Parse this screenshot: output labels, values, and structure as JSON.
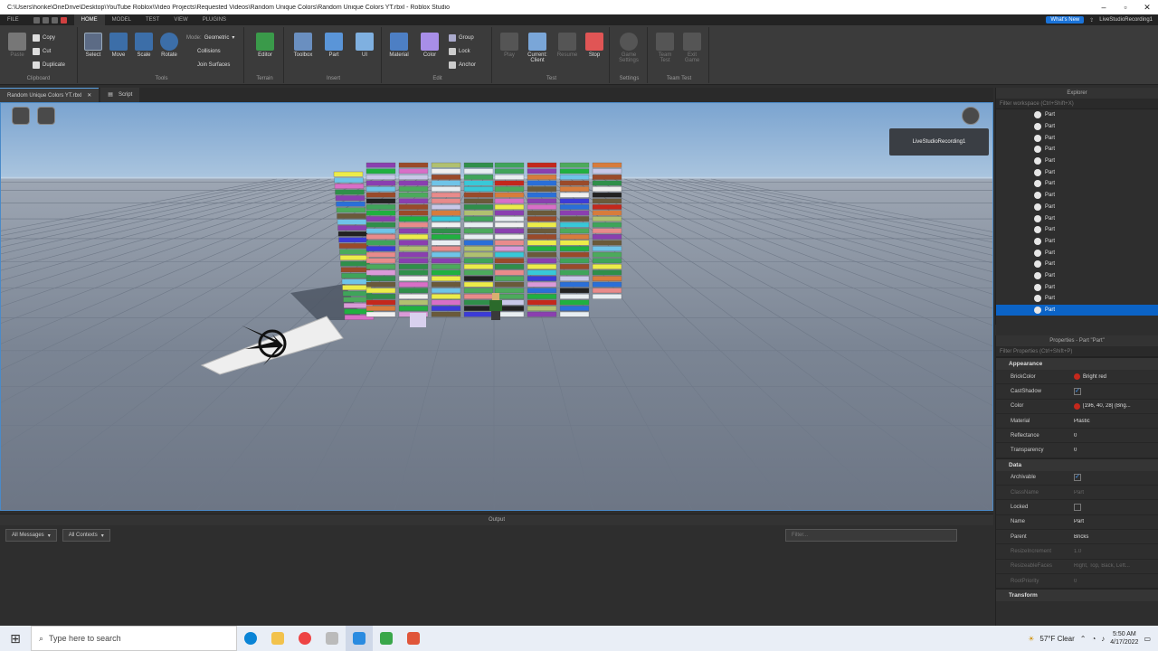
{
  "window": {
    "title": "C:\\Users\\honke\\OneDrive\\Desktop\\YouTube Roblox\\Video Projects\\Requested Videos\\Random Unique Colors\\Random Unique Colors YT.rbxl - Roblox Studio"
  },
  "menu": {
    "file": "FILE",
    "tabs": [
      "HOME",
      "MODEL",
      "TEST",
      "VIEW",
      "PLUGINS"
    ],
    "whats_new": "What's New",
    "user": "LiveStudioRecording1"
  },
  "ribbon": {
    "clipboard": {
      "paste": "Paste",
      "copy": "Copy",
      "cut": "Cut",
      "duplicate": "Duplicate",
      "label": "Clipboard"
    },
    "tools": {
      "select": "Select",
      "move": "Move",
      "scale": "Scale",
      "rotate": "Rotate",
      "mode_label": "Mode:",
      "mode_value": "Geometric",
      "collisions": "Collisions",
      "join_surfaces": "Join Surfaces",
      "label": "Tools"
    },
    "terrain": {
      "editor": "Editor",
      "label": "Terrain"
    },
    "insert": {
      "toolbox": "Toolbox",
      "part": "Part",
      "ui": "UI",
      "label": "Insert"
    },
    "edit": {
      "material": "Material",
      "color": "Color",
      "group": "Group",
      "lock": "Lock",
      "anchor": "Anchor",
      "label": "Edit"
    },
    "test": {
      "play": "Play",
      "current_client": "Current: Client",
      "resume": "Resume",
      "stop": "Stop",
      "label": "Test"
    },
    "settings": {
      "game_settings": "Game Settings",
      "label": "Settings"
    },
    "team_test": {
      "team_test": "Team Test",
      "exit_game": "Exit Game",
      "label": "Team Test"
    }
  },
  "doc_tabs": [
    {
      "label": "Random Unique Colors YT.rbxl"
    },
    {
      "label": "Script"
    }
  ],
  "viewport": {
    "recording_label": "LiveStudioRecording1"
  },
  "output": {
    "title": "Output",
    "messages_filter": "All Messages",
    "contexts_filter": "All Contexts",
    "filter_placeholder": "Filter..."
  },
  "explorer": {
    "title": "Explorer",
    "filter_placeholder": "Filter workspace (Ctrl+Shift+X)",
    "items": [
      "Part",
      "Part",
      "Part",
      "Part",
      "Part",
      "Part",
      "Part",
      "Part",
      "Part",
      "Part",
      "Part",
      "Part",
      "Part",
      "Part",
      "Part",
      "Part",
      "Part",
      "Part"
    ]
  },
  "properties": {
    "title": "Properties - Part \"Part\"",
    "filter_placeholder": "Filter Properties (Ctrl+Shift+P)",
    "sections": {
      "appearance": "Appearance",
      "data": "Data",
      "transform": "Transform"
    },
    "appearance_rows": [
      {
        "key": "BrickColor",
        "value": "Bright red",
        "swatch": "#c4281c"
      },
      {
        "key": "CastShadow",
        "value": "✓"
      },
      {
        "key": "Color",
        "value": "[196, 40, 28] (Brig...",
        "swatch": "#c4281c"
      },
      {
        "key": "Material",
        "value": "Plastic"
      },
      {
        "key": "Reflectance",
        "value": "0"
      },
      {
        "key": "Transparency",
        "value": "0"
      }
    ],
    "data_rows": [
      {
        "key": "Archivable",
        "value": "✓"
      },
      {
        "key": "ClassName",
        "value": "Part",
        "dim": true
      },
      {
        "key": "Locked",
        "value": ""
      },
      {
        "key": "Name",
        "value": "Part"
      },
      {
        "key": "Parent",
        "value": "Bricks"
      },
      {
        "key": "ResizeIncrement",
        "value": "1.0",
        "dim": true
      },
      {
        "key": "ResizeableFaces",
        "value": "Right, Top, Back, Left...",
        "dim": true
      },
      {
        "key": "RootPriority",
        "value": "0",
        "dim": true
      }
    ]
  },
  "taskbar": {
    "search_placeholder": "Type here to search",
    "weather": "57°F  Clear",
    "time": "5:50 AM",
    "date": "4/17/2022"
  },
  "colors": {
    "accent": "#0b63c6",
    "viewport_border": "#4a8ac8",
    "stop": "#e05555"
  }
}
